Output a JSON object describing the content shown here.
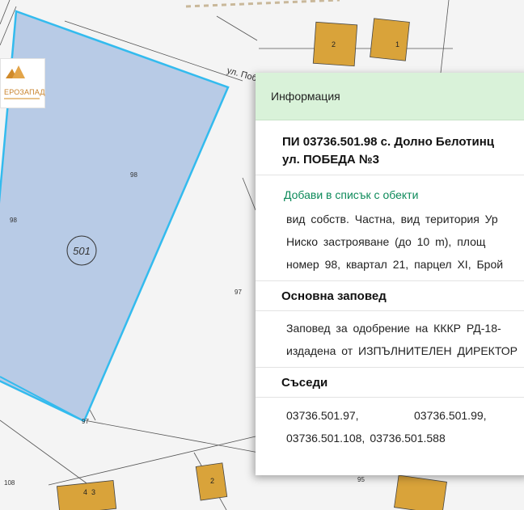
{
  "map": {
    "street_label": "ул. Поб",
    "parcel_circle_label": "501",
    "lot_labels": [
      "98",
      "98",
      "97",
      "97",
      "108",
      "95"
    ],
    "building_labels": [
      "2",
      "1",
      "2",
      "4",
      "3"
    ],
    "parcel_fill": "#b8cbe6",
    "parcel_outline": "#33bbee",
    "building_fill": "#d9a33a"
  },
  "logo": {
    "text": "ЕРОЗАПАД"
  },
  "panel": {
    "header_title": "Информация",
    "title_line1": "ПИ 03736.501.98 с. Долно Белотинц",
    "title_line2": "ул. ПОБЕДА №3",
    "add_to_list": "Добави в списък с обекти",
    "info_lines": [
      "вид собств. Частна, вид територия Ур",
      "Ниско застрояване (до 10 m), площ",
      "номер 98, квартал 21, парцел XI, Брой"
    ],
    "order_heading": "Основна заповед",
    "order_lines": [
      "Заповед за одобрение на КККР РД-18-",
      "издадена от ИЗПЪЛНИТЕЛЕН ДИРЕКТОР"
    ],
    "neighbors_heading": "Съседи",
    "neighbors": [
      "03736.501.97,",
      "03736.501.99,",
      "03736.501.108,",
      "03736.501.588"
    ]
  }
}
